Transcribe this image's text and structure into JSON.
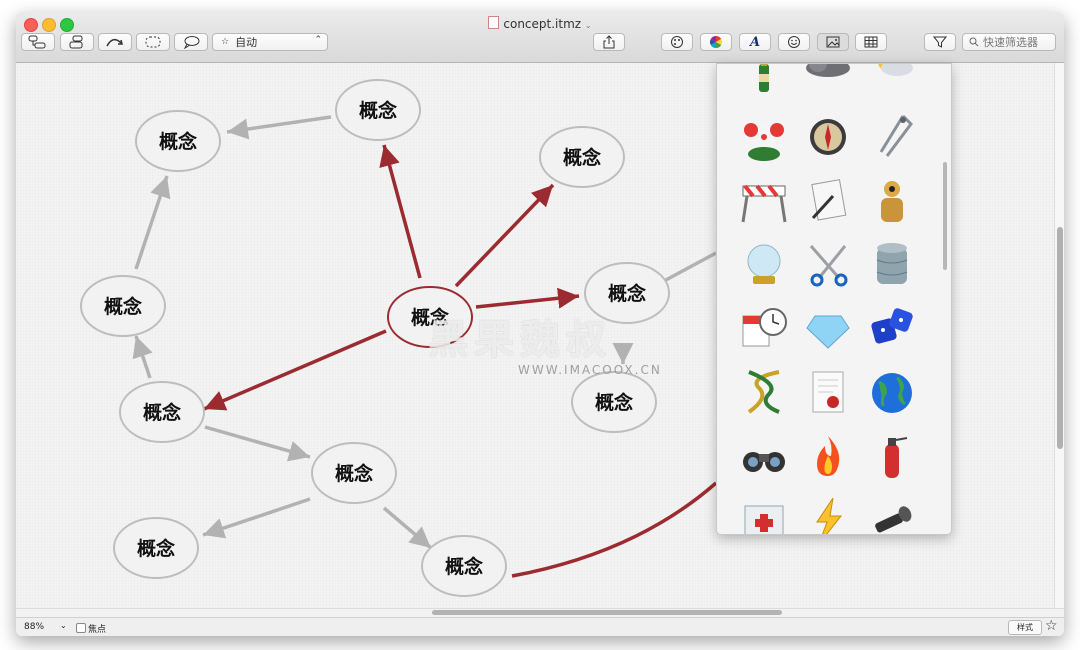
{
  "window": {
    "title": "concept.itmz"
  },
  "toolbar": {
    "layout_select_value": "自动",
    "search_placeholder": "快速筛选器"
  },
  "map": {
    "concepts": [
      {
        "id": "c1",
        "label": "概念"
      },
      {
        "id": "c2",
        "label": "概念"
      },
      {
        "id": "c3",
        "label": "概念"
      },
      {
        "id": "c4",
        "label": "概念"
      },
      {
        "id": "c5",
        "label": "概念"
      },
      {
        "id": "c6",
        "label": "概念"
      },
      {
        "id": "c7",
        "label": "概念"
      },
      {
        "id": "c8",
        "label": "概念"
      },
      {
        "id": "c9",
        "label": "概念"
      },
      {
        "id": "c10",
        "label": "概念"
      },
      {
        "id": "c11",
        "label": "概念"
      }
    ],
    "accent_color": "#9b2b30",
    "link_color": "#b2b2b2"
  },
  "icon_library": {
    "icons": [
      "champagne-icon",
      "cloud-icon",
      "sun-cloud-icon",
      "clown-icon",
      "compass-icon",
      "drawing-compass-icon",
      "barricade-icon",
      "document-pen-icon",
      "crash-dummy-icon",
      "crystal-ball-icon",
      "scissors-icon",
      "database-icon",
      "calendar-clock-icon",
      "diamond-icon",
      "dice-icon",
      "dna-icon",
      "certificate-icon",
      "globe-icon",
      "binoculars-icon",
      "fire-icon",
      "fire-extinguisher-icon",
      "first-aid-icon",
      "lightning-icon",
      "flashlight-icon"
    ]
  },
  "statusbar": {
    "zoom": "88%",
    "focus_label": "焦点",
    "style_label": "样式"
  },
  "watermark": {
    "main": "黑果魏叔",
    "sub": "WWW.IMACOOX.CN"
  }
}
